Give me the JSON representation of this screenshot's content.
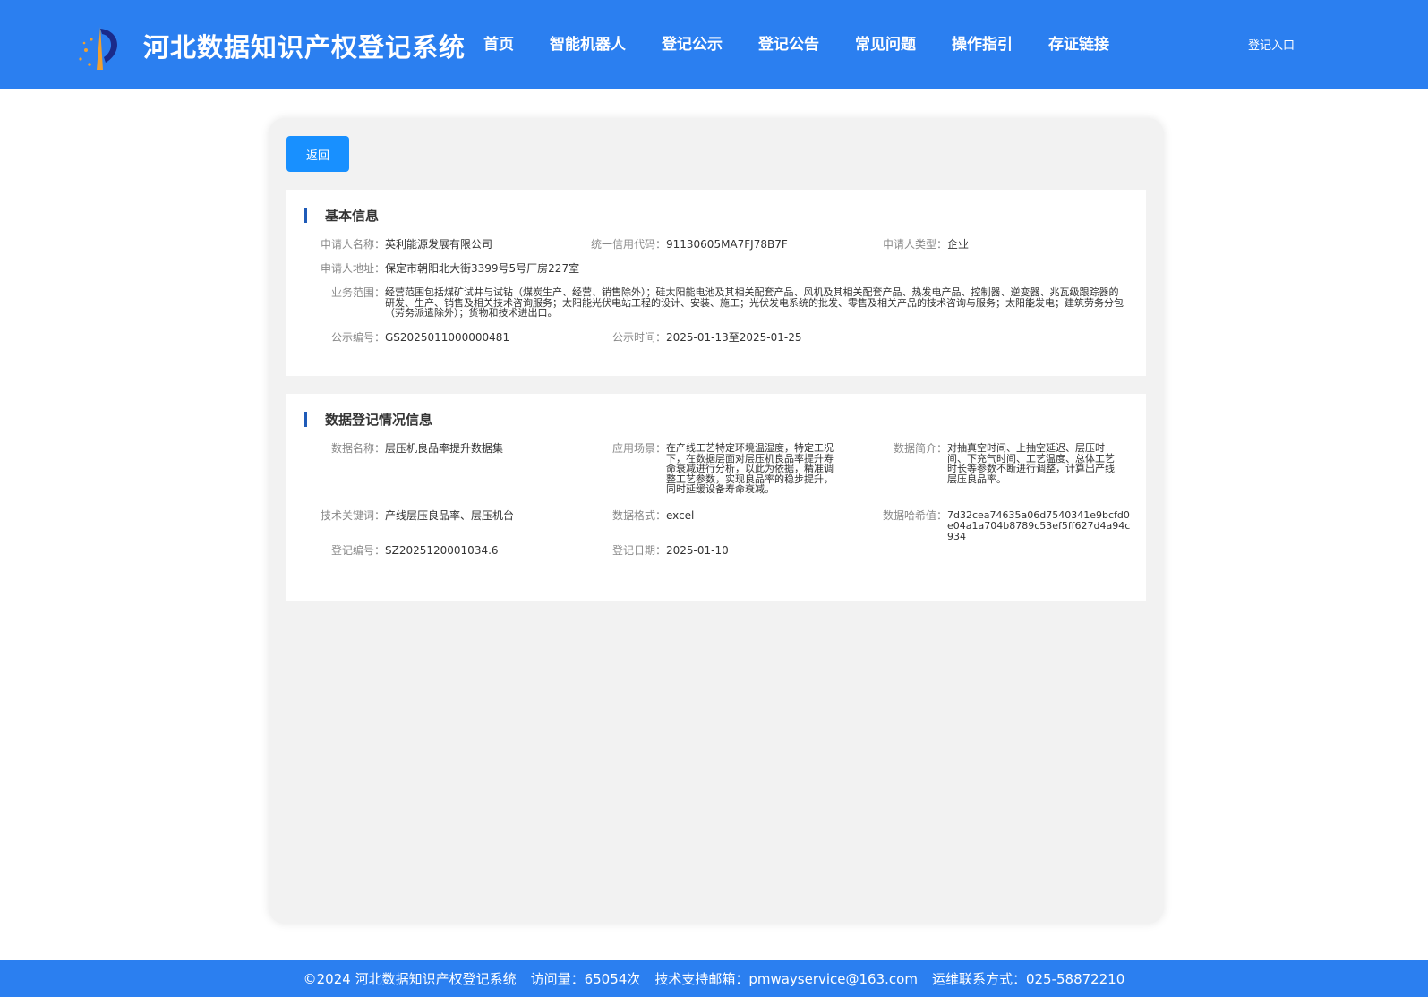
{
  "header": {
    "title": "河北数据知识产权登记系统",
    "nav": [
      "首页",
      "智能机器人",
      "登记公示",
      "登记公告",
      "常见问题",
      "操作指引",
      "存证链接"
    ],
    "login": "登记入口"
  },
  "back_label": "返回",
  "basic": {
    "title": "基本信息",
    "applicant_name_label": "申请人名称：",
    "applicant_name": "英利能源发展有限公司",
    "credit_code_label": "统一信用代码：",
    "credit_code": "91130605MA7FJ78B7F",
    "applicant_type_label": "申请人类型：",
    "applicant_type": "企业",
    "address_label": "申请人地址：",
    "address": "保定市朝阳北大街3399号5号厂房227室",
    "scope_label": "业务范围：",
    "scope": "经营范围包括煤矿试井与试钻（煤炭生产、经营、销售除外）；硅太阳能电池及其相关配套产品、风机及其相关配套产品、热发电产品、控制器、逆变器、兆瓦级跟踪器的研发、生产、销售及相关技术咨询服务；太阳能光伏电站工程的设计、安装、施工；光伏发电系统的批发、零售及相关产品的技术咨询与服务；太阳能发电；建筑劳务分包（劳务派遣除外）；货物和技术进出口。",
    "pub_no_label": "公示编号：",
    "pub_no": "GS2025011000000481",
    "pub_time_label": "公示时间：",
    "pub_time": "2025-01-13至2025-01-25"
  },
  "data": {
    "title": "数据登记情况信息",
    "name_label": "数据名称：",
    "name": "层压机良品率提升数据集",
    "scene_label": "应用场景：",
    "scene": "在产线工艺特定环境温湿度，特定工况下，在数据层面对层压机良品率提升寿命衰减进行分析，以此为依据，精准调整工艺参数，实现良品率的稳步提升，同时延缓设备寿命衰减。",
    "intro_label": "数据简介：",
    "intro": "对抽真空时间、上抽空延迟、层压时间、下充气时间、工艺温度、总体工艺时长等参数不断进行调整，计算出产线层压良品率。",
    "keywords_label": "技术关键词：",
    "keywords": "产线层压良品率、层压机台",
    "format_label": "数据格式：",
    "format": "excel",
    "hash_label": "数据哈希值：",
    "hash": "7d32cea74635a06d7540341e9bcfd0e04a1a704b8789c53ef5ff627d4a94c934",
    "reg_no_label": "登记编号：",
    "reg_no": "SZ2025120001034.6",
    "reg_date_label": "登记日期：",
    "reg_date": "2025-01-10"
  },
  "footer": {
    "copyright": "©2024 河北数据知识产权登记系统",
    "visits": "访问量：65054次",
    "email": "技术支持邮箱：pmwayservice@163.com",
    "phone": "运维联系方式：025-58872210"
  },
  "colors": {
    "header_bg": "#2b7ff0",
    "button_bg": "#1890ff",
    "section_bar": "#1f5bb8"
  }
}
